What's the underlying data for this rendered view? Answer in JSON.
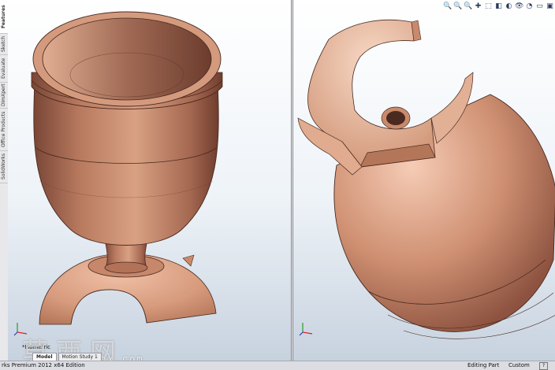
{
  "left_panel": {
    "tabs": [
      {
        "label": "Features",
        "active": true
      },
      {
        "label": "Sketch",
        "active": false
      },
      {
        "label": "Evaluate",
        "active": false
      },
      {
        "label": "DimXpert",
        "active": false
      },
      {
        "label": "Office Products",
        "active": false
      },
      {
        "label": "SolidWorks",
        "active": false
      }
    ]
  },
  "left_view": {
    "view_name": "*Isometric"
  },
  "heads_up_toolbar": [
    "🔍",
    "🔍",
    "🔍",
    "✚",
    "⬚",
    "◧",
    "◐",
    "👁",
    "◔",
    "▭",
    "▣"
  ],
  "model_tabs": [
    {
      "label": "Model",
      "active": true
    },
    {
      "label": "Motion Study 1",
      "active": false
    }
  ],
  "watermark": {
    "text": "莫西网",
    "url": "mox.com"
  },
  "status_bar": {
    "left_text": "rks Premium 2012 x64 Edition",
    "editing": "Editing Part",
    "units": "Custom",
    "help": "?"
  },
  "colors": {
    "part": "#c98a6c",
    "part_shadow": "#7a4636",
    "part_light": "#f1c3ab"
  }
}
